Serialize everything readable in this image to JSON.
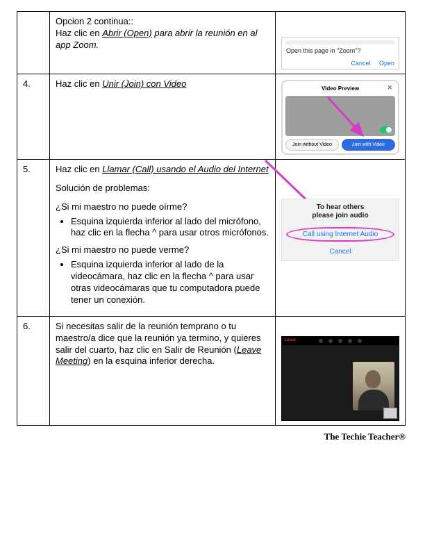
{
  "rows": {
    "r3": {
      "num": "",
      "title": "Opcion 2 continua::",
      "body_prefix": "Haz clic en ",
      "body_action": "Abrir (Open)",
      "body_suffix1": " para abrir la ",
      "body_suffix2": "reunión en al app Zoom.",
      "dialog_line": "Open this page in \"Zoom\"?",
      "btn_cancel": "Cancel",
      "btn_open": "Open"
    },
    "r4": {
      "num": "4.",
      "body_prefix": "Haz clic en ",
      "body_action": "Unir (Join) con Video",
      "preview_title": "Video Preview",
      "btn_without": "Join without Video",
      "btn_with": "Join with Video"
    },
    "r5": {
      "num": "5.",
      "line1_prefix": "Haz clic en ",
      "line1_action": "Llamar (Call) usando el Audio del Internet",
      "trouble_header": "Solución de problemas:",
      "q1": "¿Si mi maestro no puede oírme?",
      "b1": "Esquina izquierda inferior al lado del micrófono, haz clic en la flecha ^ para usar otros micrófonos.",
      "q2": "¿Si mi maestro no puede verme?",
      "b2": "Esquina izquierda inferior al lado de la videocámara, haz clic en la flecha ^ para usar otras videocámaras que tu computadora puede tener un conexión.",
      "hear1": "To hear others",
      "hear2": "please join audio",
      "call": "Call using Internet Audio",
      "cancel": "Cancel"
    },
    "r6": {
      "num": "6.",
      "body_pre": "Si necesitas salir de la reunión temprano o tu maestro/a dice que la reunión ya termino, y quieres salir del cuarto, haz clic en Salir de Reunión (",
      "body_action": "Leave Meeting",
      "body_post": ") en la esquina inferior derecha.",
      "leave": "Leave"
    }
  },
  "footer": "The Techie Teacher®"
}
